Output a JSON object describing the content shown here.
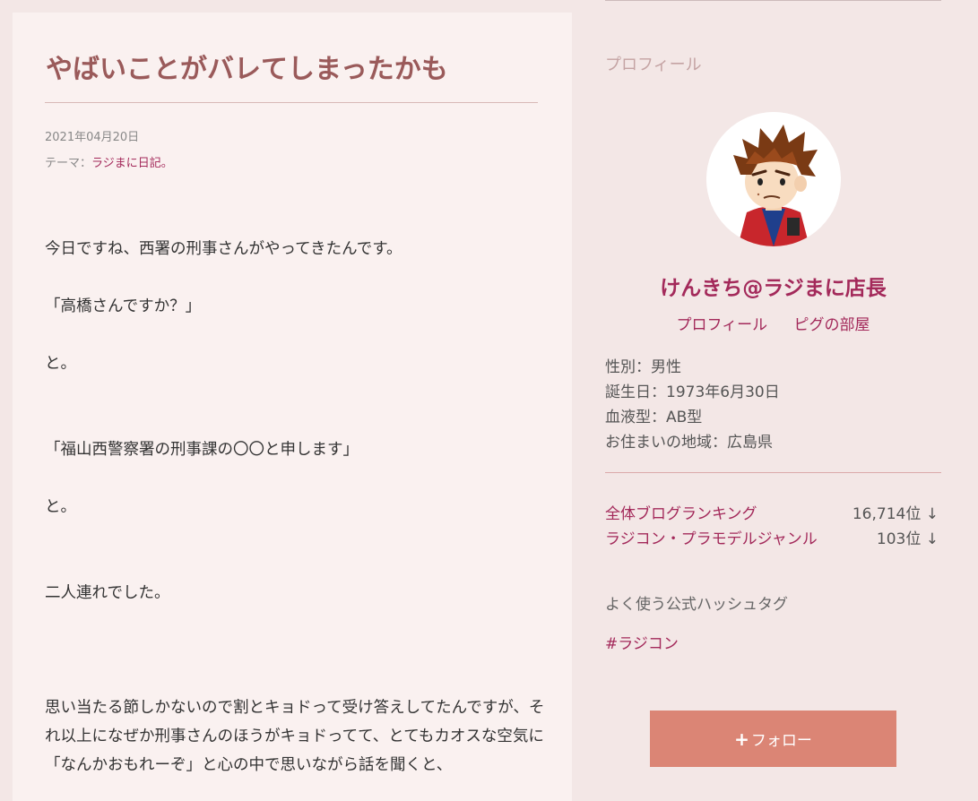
{
  "article": {
    "title": "やばいことがバレてしまったかも",
    "date": "2021年04月20日",
    "theme_label": "テーマ：",
    "theme_link": "ラジまに日記。",
    "paragraphs": [
      "今日ですね、西署の刑事さんがやってきたんです。",
      "「高橋さんですか？」",
      "と。",
      "「福山西警察署の刑事課の〇〇と申します」",
      "と。",
      "二人連れでした。",
      "思い当たる節しかないので割とキョドって受け答えしてたんですが、それ以上になぜか刑事さんのほうがキョドってて、とてもカオスな空気に「なんかおもれーぞ」と心の中で思いながら話を聞くと、"
    ]
  },
  "sidebar": {
    "heading": "プロフィール",
    "nickname": "けんきち@ラジまに店長",
    "links": [
      "プロフィール",
      "ピグの部屋"
    ],
    "info": [
      "性別：男性",
      "誕生日：1973年6月30日",
      "血液型：AB型",
      "お住まいの地域：広島県"
    ],
    "rankings": [
      {
        "label": "全体ブログランキング",
        "value": "16,714位",
        "arrow": "↓"
      },
      {
        "label": "ラジコン・プラモデルジャンル",
        "value": "103位",
        "arrow": "↓"
      }
    ],
    "hashtag_heading": "よく使う公式ハッシュタグ",
    "hashtag": "#ラジコン",
    "follow_label": "フォロー",
    "follow_plus": "+"
  },
  "colors": {
    "accent": "#a3295a",
    "title": "#9a5a5a",
    "follow_button": "#db8575",
    "page_bg": "#f3e7e6",
    "article_bg": "#faf1f0"
  },
  "icons": {
    "avatar": "cartoon-avatar",
    "follow": "plus-icon",
    "rank_trend": "down-arrow-icon"
  }
}
